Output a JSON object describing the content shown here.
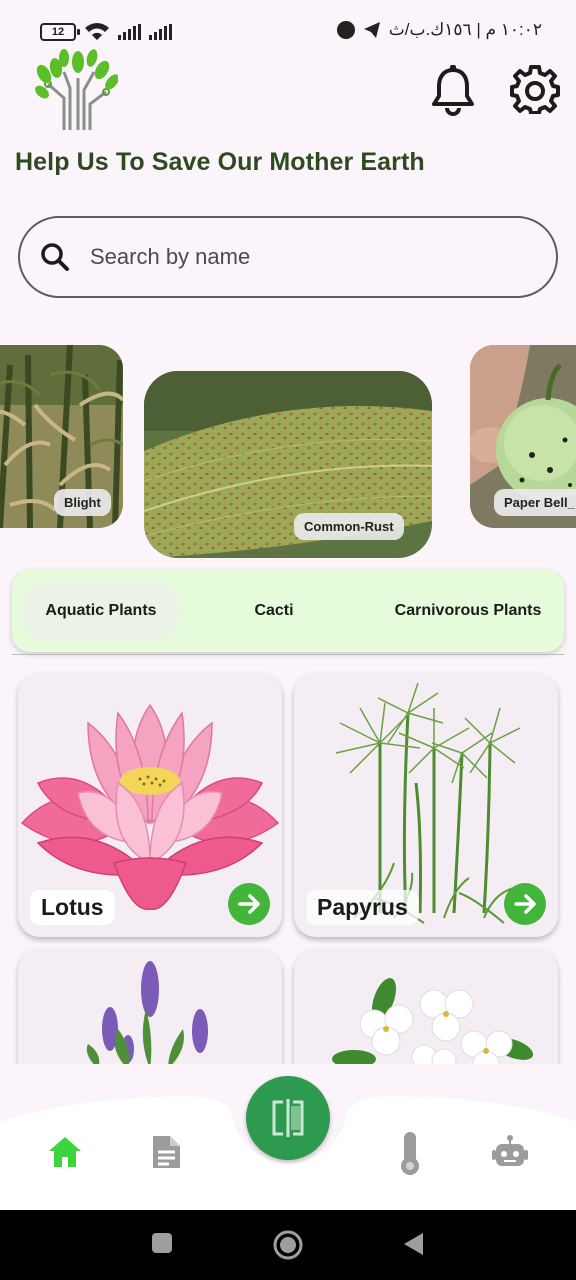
{
  "status_bar": {
    "battery": "12",
    "time_text": "١٠:٠٢ م | ١٥٦ك.ب/ث"
  },
  "header": {
    "logo_icon": "tree-circuit-logo-icon",
    "notification_icon": "bell-icon",
    "settings_icon": "gear-icon",
    "headline": "Help Us To Save Our Mother Earth"
  },
  "search": {
    "placeholder": "Search by name",
    "icon": "search-icon"
  },
  "diseases": [
    {
      "label": "Blight"
    },
    {
      "label": "Common-Rust"
    },
    {
      "label": "Paper Bell_"
    }
  ],
  "categories": {
    "tabs": [
      {
        "label": "Aquatic Plants",
        "active": true
      },
      {
        "label": "Cacti",
        "active": false
      },
      {
        "label": "Carnivorous Plants",
        "active": false
      }
    ]
  },
  "plants": [
    {
      "name": "Lotus"
    },
    {
      "name": "Papyrus"
    },
    {
      "name": ""
    },
    {
      "name": ""
    }
  ],
  "bottom_nav": {
    "items": [
      {
        "icon": "home-icon",
        "active": true
      },
      {
        "icon": "document-icon",
        "active": false
      },
      {
        "icon": "scan-icon",
        "center": true
      },
      {
        "icon": "thermometer-icon",
        "active": false
      },
      {
        "icon": "robot-icon",
        "active": false
      }
    ]
  },
  "colors": {
    "accent_green": "#2e9a50",
    "headline_green": "#2f4a21",
    "tab_bg": "#e6fbd9",
    "arrow_green": "#43b53a",
    "home_active": "#3ed43e"
  }
}
